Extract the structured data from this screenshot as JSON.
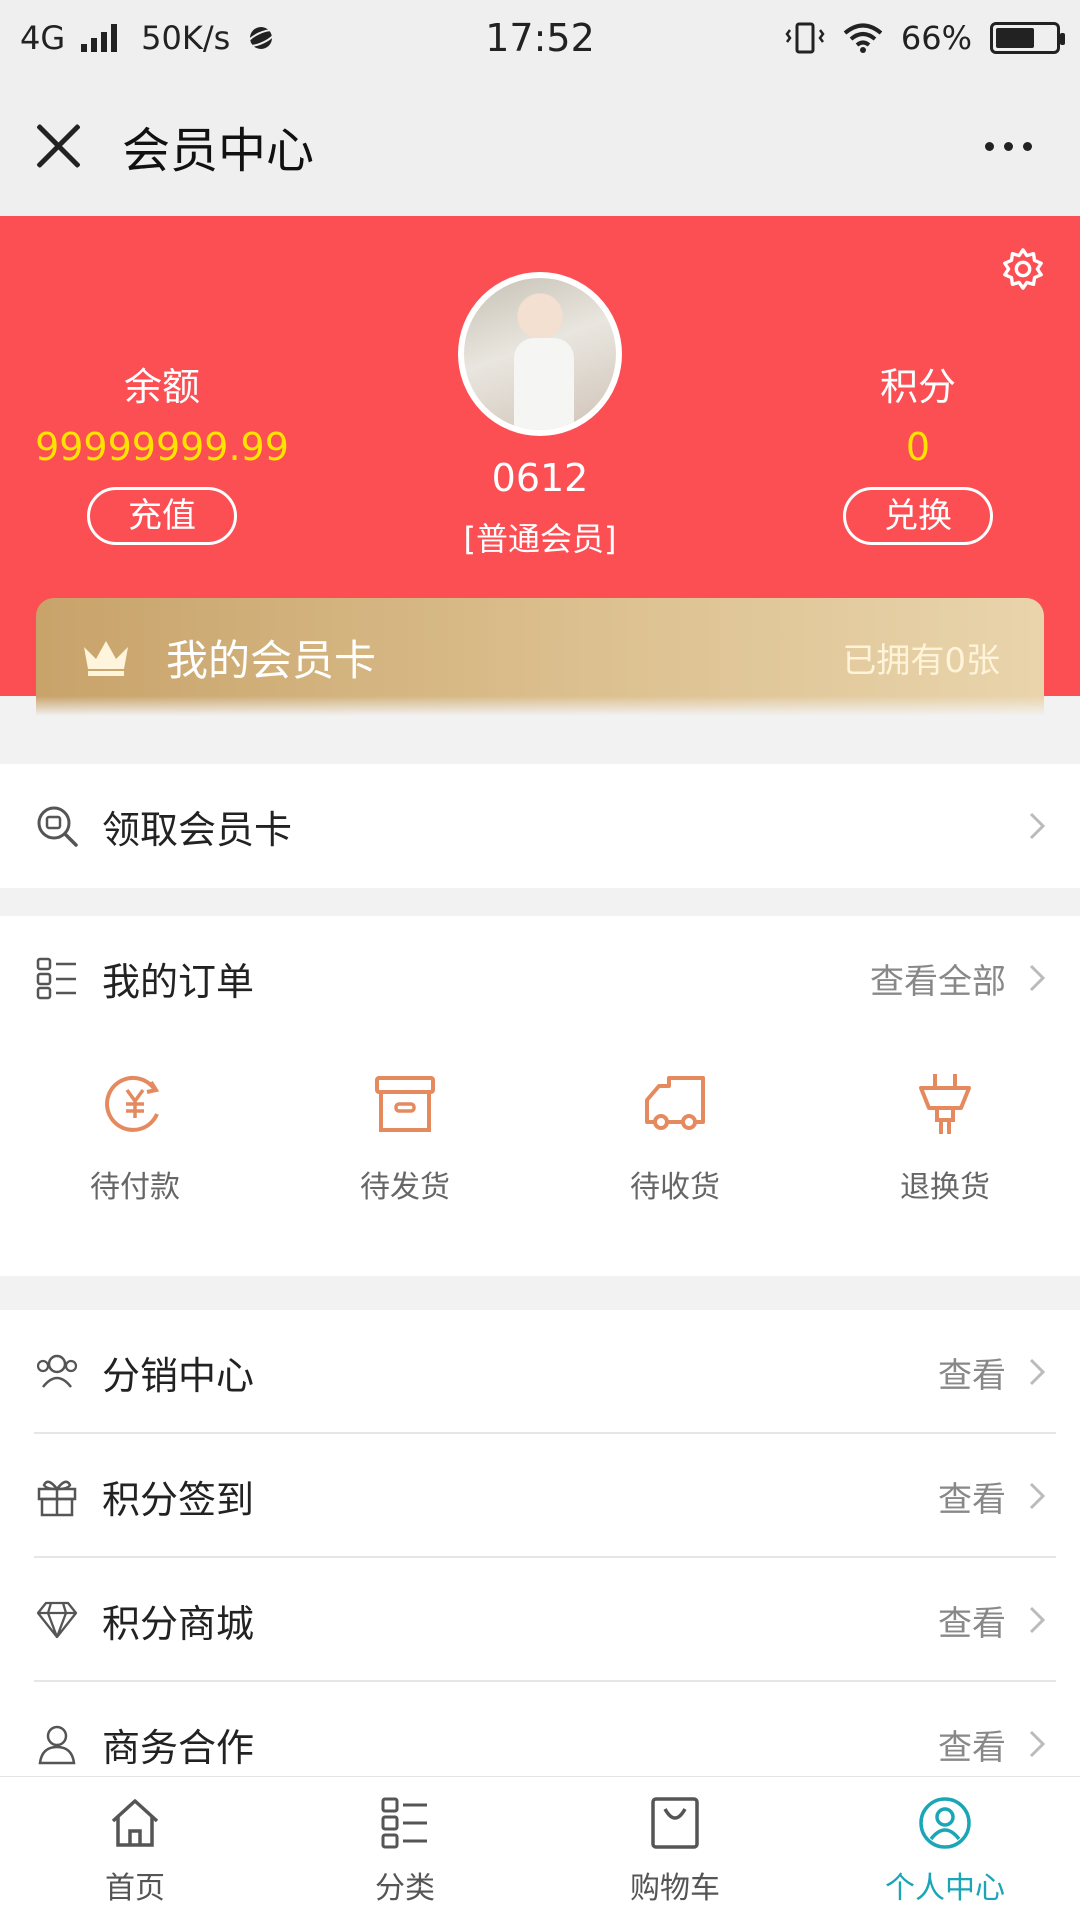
{
  "status_bar": {
    "network": "4G",
    "speed": "50K/s",
    "time": "17:52",
    "battery": "66%",
    "battery_level": 0.66
  },
  "title_bar": {
    "title": "会员中心"
  },
  "member": {
    "balance_label": "余额",
    "balance_value": "99999999.99",
    "recharge_label": "充值",
    "username": "0612",
    "level": "[普通会员]",
    "points_label": "积分",
    "points_value": "0",
    "exchange_label": "兑换"
  },
  "member_card": {
    "title": "我的会员卡",
    "count": "已拥有0张"
  },
  "get_card": {
    "label": "领取会员卡"
  },
  "orders": {
    "label": "我的订单",
    "view_all": "查看全部",
    "items": [
      {
        "label": "待付款",
        "icon": "payment-pending-icon"
      },
      {
        "label": "待发货",
        "icon": "box-icon"
      },
      {
        "label": "待收货",
        "icon": "truck-icon"
      },
      {
        "label": "退换货",
        "icon": "plug-icon"
      }
    ]
  },
  "menu": [
    {
      "label": "分销中心",
      "right": "查看",
      "icon": "people-icon"
    },
    {
      "label": "积分签到",
      "right": "查看",
      "icon": "gift-icon"
    },
    {
      "label": "积分商城",
      "right": "查看",
      "icon": "diamond-icon"
    },
    {
      "label": "商务合作",
      "right": "查看",
      "icon": "user-icon"
    }
  ],
  "tabs": [
    {
      "label": "首页",
      "icon": "home-icon"
    },
    {
      "label": "分类",
      "icon": "category-icon"
    },
    {
      "label": "购物车",
      "icon": "cart-icon"
    },
    {
      "label": "个人中心",
      "icon": "profile-icon"
    }
  ],
  "colors": {
    "header_red": "#fb4f54",
    "value_yellow": "#ffe300",
    "order_icon": "#e58a5e",
    "active_tab": "#1aa6b7"
  }
}
